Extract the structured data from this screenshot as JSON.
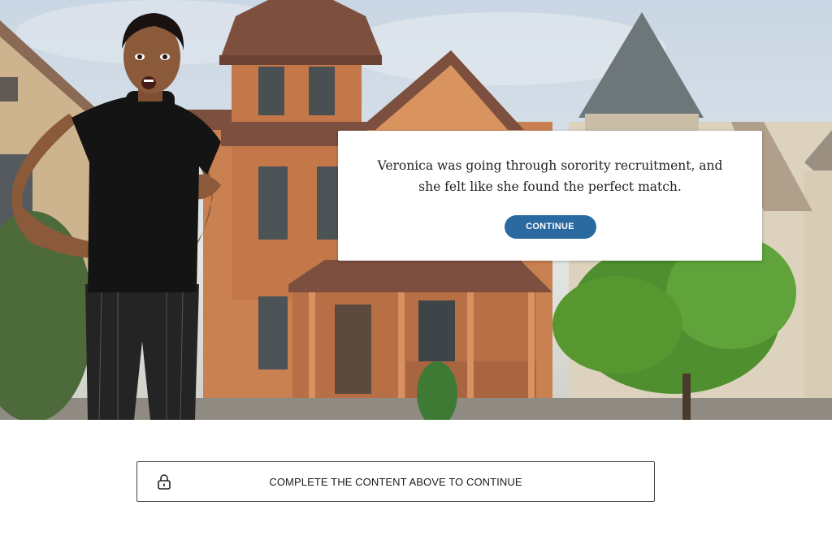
{
  "scene": {
    "dialog": {
      "text": "Veronica was going through sorority recruitment, and she felt like she found the perfect match.",
      "continue_label": "CONTINUE"
    }
  },
  "footer": {
    "locked_label": "COMPLETE THE CONTENT ABOVE TO CONTINUE",
    "icon": "lock-icon"
  },
  "colors": {
    "accent": "#2b6aa1",
    "house": "#c98152",
    "roof": "#7d4f3e"
  }
}
